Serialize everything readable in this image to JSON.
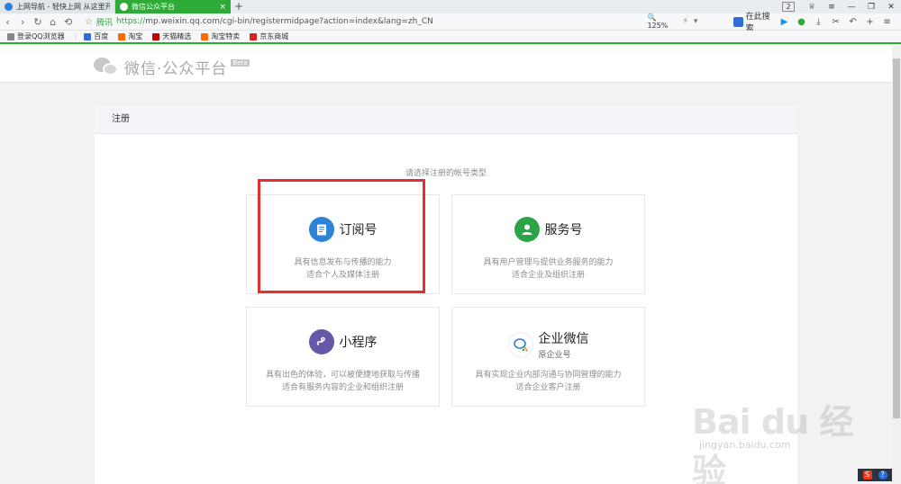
{
  "browser": {
    "tabs": [
      {
        "label": "上网导航 - 轻快上网 从这里开",
        "active": false,
        "close": ""
      },
      {
        "label": "微信公众平台",
        "active": true,
        "close": "×"
      }
    ],
    "new_tab": "+",
    "tab_count_badge": "2",
    "address": {
      "secure_label": "腾讯",
      "scheme": "https://",
      "rest": "mp.weixin.qq.com/cgi-bin/registermidpage?action=index&lang=zh_CN"
    },
    "zoom": "125%",
    "search_engine_label": "在此搜索",
    "bookmarks": [
      {
        "label": "登录QQ浏览器",
        "color": "#888888"
      },
      {
        "label": "百度",
        "color": "#2f6ed8"
      },
      {
        "label": "淘宝",
        "color": "#ff6a00"
      },
      {
        "label": "天猫精选",
        "color": "#c40000"
      },
      {
        "label": "淘宝特卖",
        "color": "#ff6a00"
      },
      {
        "label": "京东商城",
        "color": "#d9231c"
      }
    ]
  },
  "header": {
    "logo_text": "微信·公众平台",
    "beta": "Beta"
  },
  "panel": {
    "title": "注册",
    "hint": "请选择注册的帐号类型",
    "cards": [
      {
        "name": "订阅号",
        "sub": "",
        "desc_line1": "具有信息发布与传播的能力",
        "desc_line2": "适合个人及媒体注册",
        "icon": "document-icon"
      },
      {
        "name": "服务号",
        "sub": "",
        "desc_line1": "具有用户管理与提供业务服务的能力",
        "desc_line2": "适合企业及组织注册",
        "icon": "user-icon"
      },
      {
        "name": "小程序",
        "sub": "",
        "desc_line1": "具有出色的体验，可以被便捷地获取与传播",
        "desc_line2": "适合有服务内容的企业和组织注册",
        "icon": "link-icon"
      },
      {
        "name": "企业微信",
        "sub": "原企业号",
        "desc_line1": "具有实现企业内部沟通与协同管理的能力",
        "desc_line2": "适合企业客户注册",
        "icon": "wework-icon"
      }
    ]
  },
  "watermark": {
    "text": "Bai du 经验",
    "sub": "jingyan.baidu.com"
  },
  "colors": {
    "accent_green": "#2eaa36",
    "highlight_red": "#e72e2e"
  }
}
